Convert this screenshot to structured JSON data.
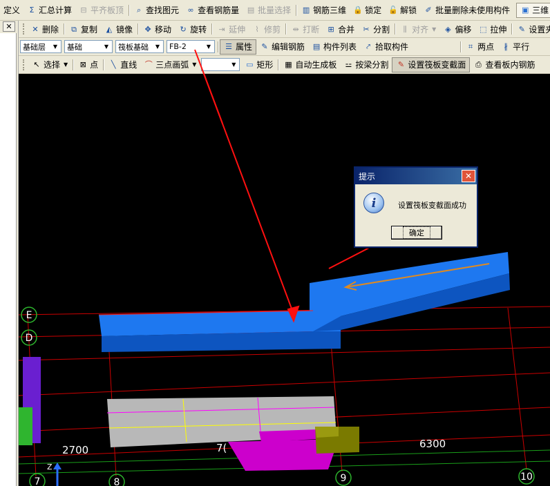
{
  "menubar": {
    "items": [
      {
        "label": "定义",
        "icon": "none",
        "disabled": false
      },
      {
        "label": "汇总计算",
        "icon": "sigma-icon",
        "disabled": false
      },
      {
        "label": "平齐板顶",
        "icon": "flush-icon",
        "disabled": true
      },
      {
        "label": "查找图元",
        "icon": "find-icon",
        "disabled": false
      },
      {
        "label": "查看钢筋量",
        "icon": "glasses-icon",
        "disabled": false
      },
      {
        "label": "批量选择",
        "icon": "batch-select-icon",
        "disabled": true
      },
      {
        "label": "钢筋三维",
        "icon": "rebar-3d-icon",
        "disabled": false
      },
      {
        "label": "锁定",
        "icon": "lock-icon",
        "disabled": false
      },
      {
        "label": "解锁",
        "icon": "unlock-icon",
        "disabled": false
      },
      {
        "label": "批量删除未使用构件",
        "icon": "batch-delete-icon",
        "disabled": false
      }
    ],
    "view_mode": "三维"
  },
  "toolbar2": {
    "items": [
      {
        "label": "删除",
        "icon": "delete-icon",
        "disabled": false
      },
      {
        "label": "复制",
        "icon": "copy-icon",
        "disabled": false
      },
      {
        "label": "镜像",
        "icon": "mirror-icon",
        "disabled": false
      },
      {
        "label": "移动",
        "icon": "move-icon",
        "disabled": false
      },
      {
        "label": "旋转",
        "icon": "rotate-icon",
        "disabled": false
      },
      {
        "label": "延伸",
        "icon": "extend-icon",
        "disabled": true
      },
      {
        "label": "修剪",
        "icon": "trim-icon",
        "disabled": true
      },
      {
        "label": "打断",
        "icon": "break-icon",
        "disabled": true
      },
      {
        "label": "合并",
        "icon": "merge-icon",
        "disabled": false
      },
      {
        "label": "分割",
        "icon": "split-icon",
        "disabled": false
      },
      {
        "label": "对齐",
        "icon": "align-icon",
        "disabled": true
      },
      {
        "label": "偏移",
        "icon": "offset-icon",
        "disabled": false
      },
      {
        "label": "拉伸",
        "icon": "stretch-icon",
        "disabled": false
      },
      {
        "label": "设置夹",
        "icon": "set-grip-icon",
        "disabled": false
      }
    ]
  },
  "toolbar3": {
    "floor": "基础层",
    "category": "基础",
    "component_type": "筏板基础",
    "component": "FB-2",
    "buttons": [
      {
        "label": "属性",
        "icon": "properties-icon",
        "pressed": true
      },
      {
        "label": "编辑钢筋",
        "icon": "edit-rebar-icon",
        "pressed": false
      },
      {
        "label": "构件列表",
        "icon": "component-list-icon",
        "pressed": false
      },
      {
        "label": "拾取构件",
        "icon": "pick-icon",
        "pressed": false
      }
    ],
    "right_buttons": [
      {
        "label": "两点",
        "icon": "two-point-icon"
      },
      {
        "label": "平行",
        "icon": "parallel-icon"
      }
    ]
  },
  "toolbar4": {
    "select_label": "选择",
    "point_label": "点",
    "line_label": "直线",
    "arc_label": "三点画弧",
    "arc_combo": "",
    "rect_label": "矩形",
    "auto_label": "自动生成板",
    "beam_split_label": "按梁分割",
    "set_section_label": "设置筏板变截面",
    "view_rebar_label": "查看板内钢筋"
  },
  "dialog": {
    "title": "提示",
    "message": "设置筏板变截面成功",
    "ok_label": "确定"
  },
  "viewport": {
    "axis_labels": [
      "E",
      "D",
      "7",
      "8",
      "9",
      "10"
    ],
    "dimensions": [
      "2700",
      "6300"
    ],
    "partial_dimension": "7(",
    "z_axis": "Z"
  },
  "colors": {
    "slab": "#1565d8",
    "annotation_arrow": "#ff1010",
    "grid_line": "#cc0000",
    "axis_circle": "#2db52d"
  }
}
